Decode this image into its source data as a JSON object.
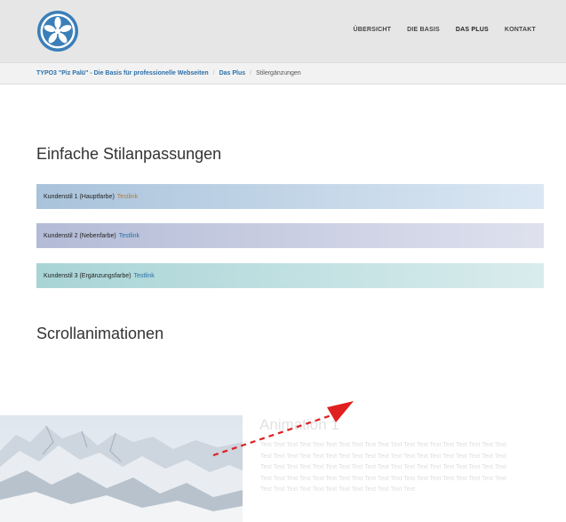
{
  "nav": {
    "items": [
      {
        "label": "ÜBERSICHT"
      },
      {
        "label": "DIE BASIS"
      },
      {
        "label": "DAS PLUS"
      },
      {
        "label": "KONTAKT"
      }
    ]
  },
  "breadcrumb": {
    "items": [
      {
        "label": "TYPO3 \"Piz Palü\" - Die Basis für professionelle Webseiten"
      },
      {
        "label": "Das Plus"
      },
      {
        "label": "Stilergänzungen"
      }
    ]
  },
  "sections": {
    "simple_title": "Einfache Stilanpassungen",
    "scroll_title": "Scrollanimationen"
  },
  "style_boxes": [
    {
      "text": "Kundenstil 1 (Hauptfarbe)",
      "link": "Testlink"
    },
    {
      "text": "Kundenstil 2 (Nebenfarbe)",
      "link": "Testlink"
    },
    {
      "text": "Kundenstil 3 (Ergänzungsfarbe)",
      "link": "Testlink"
    }
  ],
  "animation": {
    "title": "Animation 1",
    "text": "Text Text Text Text Text Text Text Text Text Text Text Text Text Text Text Text Text Text Text Text Text Text Text Text Text Text Text Text Text Text Text Text Text Text Text Text Text Text Text Text Text Text Text Text Text Text Text Text Text Text Text Text Text Text Text Text Text Text Text Text Text Text Text Text Text Text Text Text Text Text Text Text Text Text Text Text Text Text Text Text Text Text Text Text Text Text Text Text"
  },
  "colors": {
    "link_blue": "#2a6fa8",
    "logo_blue": "#3a7fb8",
    "arrow_red": "#e02020",
    "testlink_brown": "#b47b3a"
  }
}
